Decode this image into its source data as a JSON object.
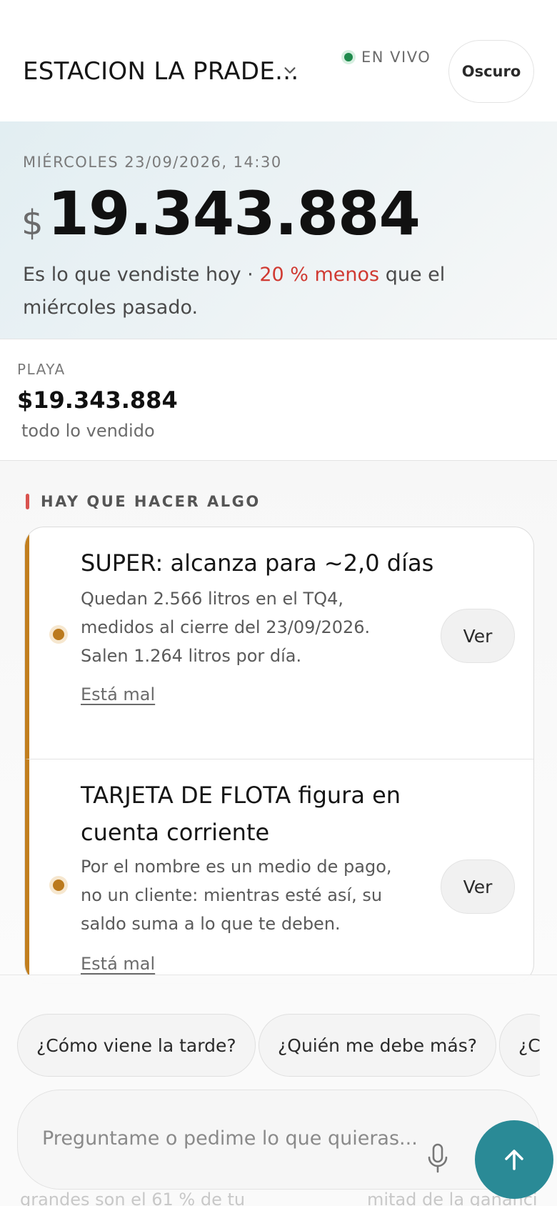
{
  "header": {
    "station": "ESTACION LA PRADE...",
    "live_label": "EN VIVO",
    "theme_button": "Oscuro"
  },
  "hero": {
    "date": "MIÉRCOLES 23/09/2026, 14:30",
    "currency": "$",
    "amount": "19.343.884",
    "desc_pre": "Es lo que vendiste hoy · ",
    "desc_highlight": "20 % menos",
    "desc_post": " que el miércoles pasado."
  },
  "playa": {
    "label": "PLAYA",
    "amount": "$19.343.884",
    "sub": "todo lo vendido"
  },
  "alerts": {
    "section_title": "HAY QUE HACER ALGO",
    "accent": "#c27f1f",
    "items": [
      {
        "title": "SUPER: alcanza para ~2,0 días",
        "body": "Quedan 2.566 litros en el TQ4, medidos al cierre del 23/09/2026. Salen 1.264 litros por día.",
        "link": "Está mal",
        "button": "Ver"
      },
      {
        "title": "TARJETA DE FLOTA figura en cuenta corriente",
        "body": "Por el nombre es un medio de pago, no un cliente: mientras esté así, su saldo suma a lo que te deben.",
        "link": "Está mal",
        "button": "Ver"
      }
    ]
  },
  "suggestions": [
    "¿Cómo viene la tarde?",
    "¿Quién me debe más?",
    "¿C"
  ],
  "composer": {
    "placeholder": "Preguntame o pedime lo que quieras...",
    "mic_icon": "microphone-icon",
    "send_icon": "arrow-up-icon",
    "send_color": "#2a8a96"
  },
  "background_text": {
    "left": "grandes son el 61 % de tu",
    "right": "mitad de la gananci"
  }
}
